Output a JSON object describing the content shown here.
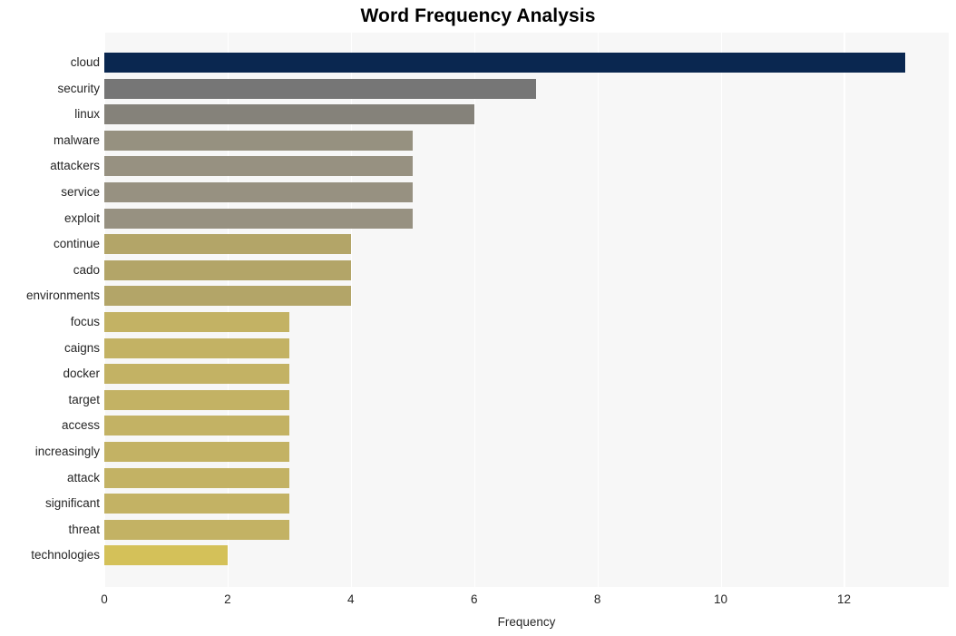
{
  "chart_data": {
    "type": "bar",
    "orientation": "horizontal",
    "title": "Word Frequency Analysis",
    "xlabel": "Frequency",
    "ylabel": "",
    "xlim": [
      0,
      13.7
    ],
    "ylim": null,
    "grid": true,
    "grid_axis": "x",
    "legend": false,
    "legend_position": "none",
    "categories": [
      "cloud",
      "security",
      "linux",
      "malware",
      "attackers",
      "service",
      "exploit",
      "continue",
      "cado",
      "environments",
      "focus",
      "caigns",
      "docker",
      "target",
      "access",
      "increasingly",
      "attack",
      "significant",
      "threat",
      "technologies"
    ],
    "values": [
      13,
      7,
      6,
      5,
      5,
      5,
      5,
      4,
      4,
      4,
      3,
      3,
      3,
      3,
      3,
      3,
      3,
      3,
      3,
      2
    ],
    "xticks": [
      0,
      2,
      4,
      6,
      8,
      10,
      12
    ],
    "xtick_labels": [
      "0",
      "2",
      "4",
      "6",
      "8",
      "10",
      "12"
    ],
    "bar_colors": [
      "#0a2750",
      "#767676",
      "#85827a",
      "#969180",
      "#979181",
      "#979181",
      "#979181",
      "#b3a568",
      "#b3a568",
      "#b3a568",
      "#c3b264",
      "#c3b264",
      "#c3b264",
      "#c3b264",
      "#c3b264",
      "#c3b264",
      "#c3b264",
      "#c3b264",
      "#c3b264",
      "#d4c159"
    ],
    "plot_background": "#f7f7f7",
    "figure_background": "#ffffff",
    "gridline_color": "#ffffff",
    "text_color": "#262626"
  }
}
